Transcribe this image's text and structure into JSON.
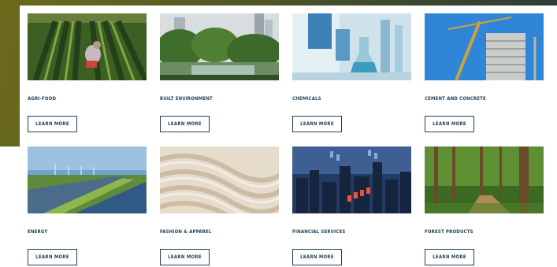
{
  "industries": [
    {
      "title": "AGRI-FOOD",
      "button": "LEARN MORE"
    },
    {
      "title": "BUILT ENVIRONMENT",
      "button": "LEARN MORE"
    },
    {
      "title": "CHEMICALS",
      "button": "LEARN MORE"
    },
    {
      "title": "CEMENT AND CONCRETE",
      "button": "LEARN MORE"
    },
    {
      "title": "ENERGY",
      "button": "LEARN MORE"
    },
    {
      "title": "FASHION & APPAREL",
      "button": "LEARN MORE"
    },
    {
      "title": "FINANCIAL SERVICES",
      "button": "LEARN MORE"
    },
    {
      "title": "FOREST PRODUCTS",
      "button": "LEARN MORE"
    }
  ],
  "colors": {
    "text": "#1f3f54",
    "background_accent": "#5a5d23"
  }
}
